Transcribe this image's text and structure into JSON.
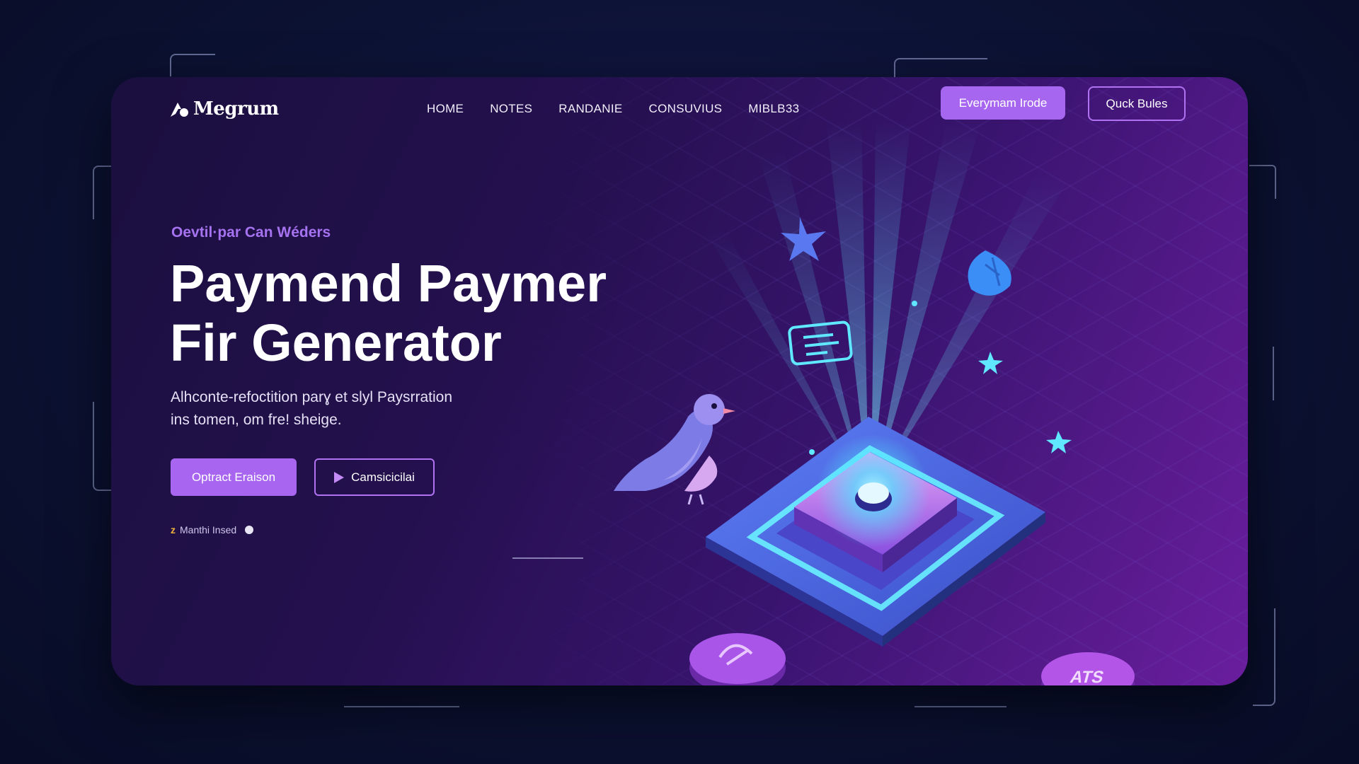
{
  "brand": {
    "name": "Megrum",
    "logo_icon": "mountain-logo-icon"
  },
  "nav": {
    "items": [
      "HOME",
      "NOTES",
      "RANDANIE",
      "CONSUVIUS",
      "MIBLB33"
    ]
  },
  "header_actions": {
    "primary": "Everymam Irode",
    "secondary": "Quck Bules"
  },
  "hero": {
    "eyebrow": "Oevtil·par Can Wéders",
    "title_line1": "Paymend Paymer",
    "title_line2": "Fir Generator",
    "desc_line1": "Alhconte-refoctition parɣ et slyl Paysrration",
    "desc_line2": "ins tomen, om fre! sheige.",
    "cta_primary": "Optract Eraison",
    "cta_secondary": "Camsicicilai",
    "meta_text": "Manthi Insed"
  },
  "illustration": {
    "left_badge_text": "",
    "right_badge_text": "ATS",
    "icons": [
      "star-icon",
      "leaf-icon",
      "document-icon",
      "bird-icon",
      "chip-icon"
    ]
  },
  "colors": {
    "accent": "#a766f0",
    "background": "#0c1233",
    "glow": "#4fe3ff"
  }
}
